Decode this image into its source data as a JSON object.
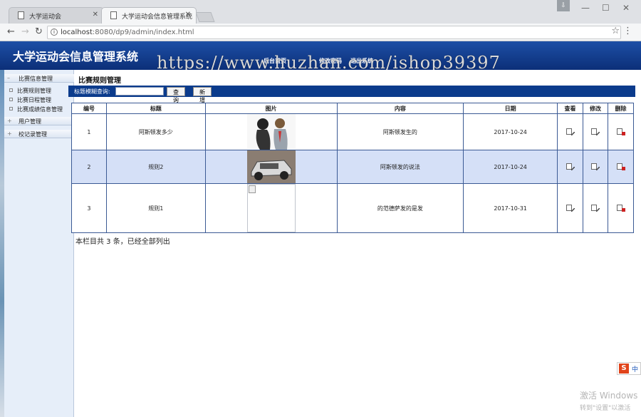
{
  "browser": {
    "tabs": [
      {
        "title": "大学运动会",
        "active": false
      },
      {
        "title": "大学运动会信息管理系统",
        "active": true
      }
    ],
    "url_host": "localhost",
    "url_path": ":8080/dp9/admin/index.html"
  },
  "app": {
    "title": "大学运动会信息管理系统",
    "topnav": [
      "后台首页",
      "修改密码",
      "退出系统"
    ]
  },
  "watermark": "https://www.huzhan.com/ishop39397",
  "sidebar": {
    "groups": [
      {
        "label": "比赛信息管理",
        "items": [
          "比赛规则管理",
          "比赛日程管理",
          "比赛成绩信息管理"
        ]
      },
      {
        "label": "用户管理",
        "items": []
      },
      {
        "label": "校记录管理",
        "items": []
      }
    ]
  },
  "main": {
    "title": "比赛规则管理",
    "search_label": "标题模糊查询:",
    "search_value": "",
    "search_button": "查 询",
    "add_button": "新 增",
    "columns": [
      "编号",
      "标题",
      "图片",
      "内容",
      "日期",
      "查看",
      "修改",
      "删除"
    ],
    "rows": [
      {
        "id": "1",
        "title": "阿斯顿发多少",
        "content": "阿斯顿发生的",
        "date": "2017-10-24"
      },
      {
        "id": "2",
        "title": "规则2",
        "content": "阿斯顿发的说法",
        "date": "2017-10-24"
      },
      {
        "id": "3",
        "title": "规则1",
        "content": "的范德萨发的是发",
        "date": "2017-10-31"
      }
    ],
    "footer_note": "本栏目共 3 条，已经全部列出"
  },
  "os": {
    "activate_title": "激活 Windows",
    "activate_hint": "转到\"设置\"以激活",
    "ime_label": "中"
  },
  "colors": {
    "header_blue": "#0c2f78",
    "search_bar": "#0b3b8c",
    "row_highlight": "#d5e0f7"
  }
}
